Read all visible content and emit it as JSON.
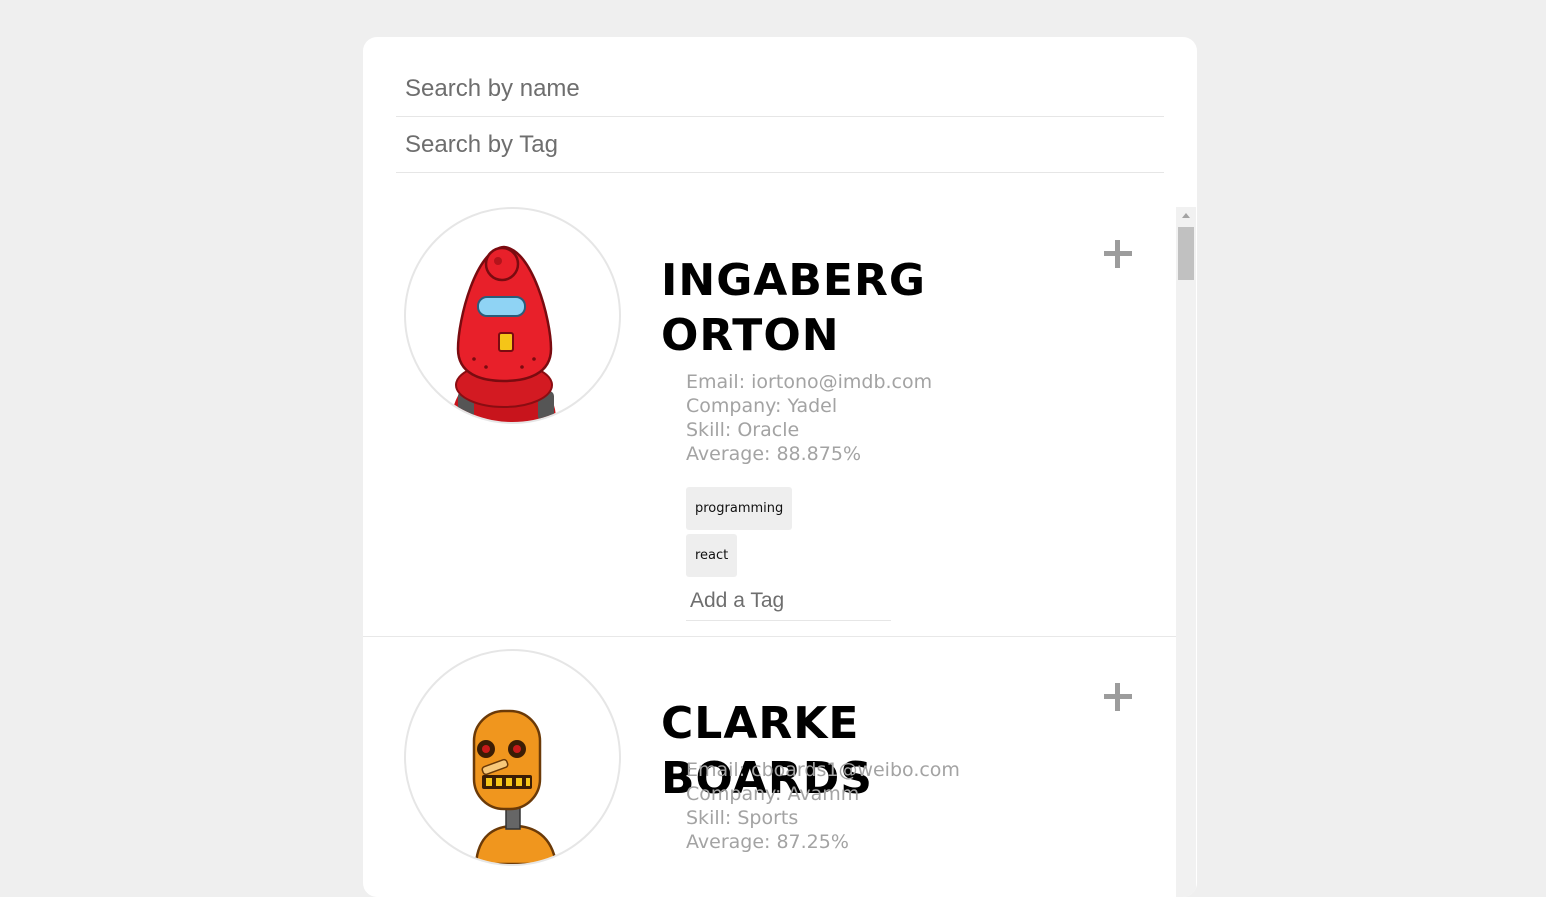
{
  "search": {
    "name_placeholder": "Search by name",
    "tag_placeholder": "Search by Tag"
  },
  "students": [
    {
      "name_line1": "INGABERG",
      "name_line2": "ORTON",
      "email": "Email: iortono@imdb.com",
      "company": "Company: Yadel",
      "skill": "Skill: Oracle",
      "average": "Average: 88.875%",
      "avatar_color": "#e8202a",
      "tags": [
        "programming",
        "react"
      ],
      "tag_placeholder": "Add a Tag"
    },
    {
      "name": "CLARKE BOARDS",
      "email": "Email: cboards1@weibo.com",
      "company": "Company: Avamm",
      "skill": "Skill: Sports",
      "average": "Average: 87.25%",
      "avatar_color": "#f0961e"
    }
  ],
  "icons": {
    "expand": "plus-icon",
    "avatar_1": "red-robot-icon",
    "avatar_2": "orange-robot-icon"
  }
}
